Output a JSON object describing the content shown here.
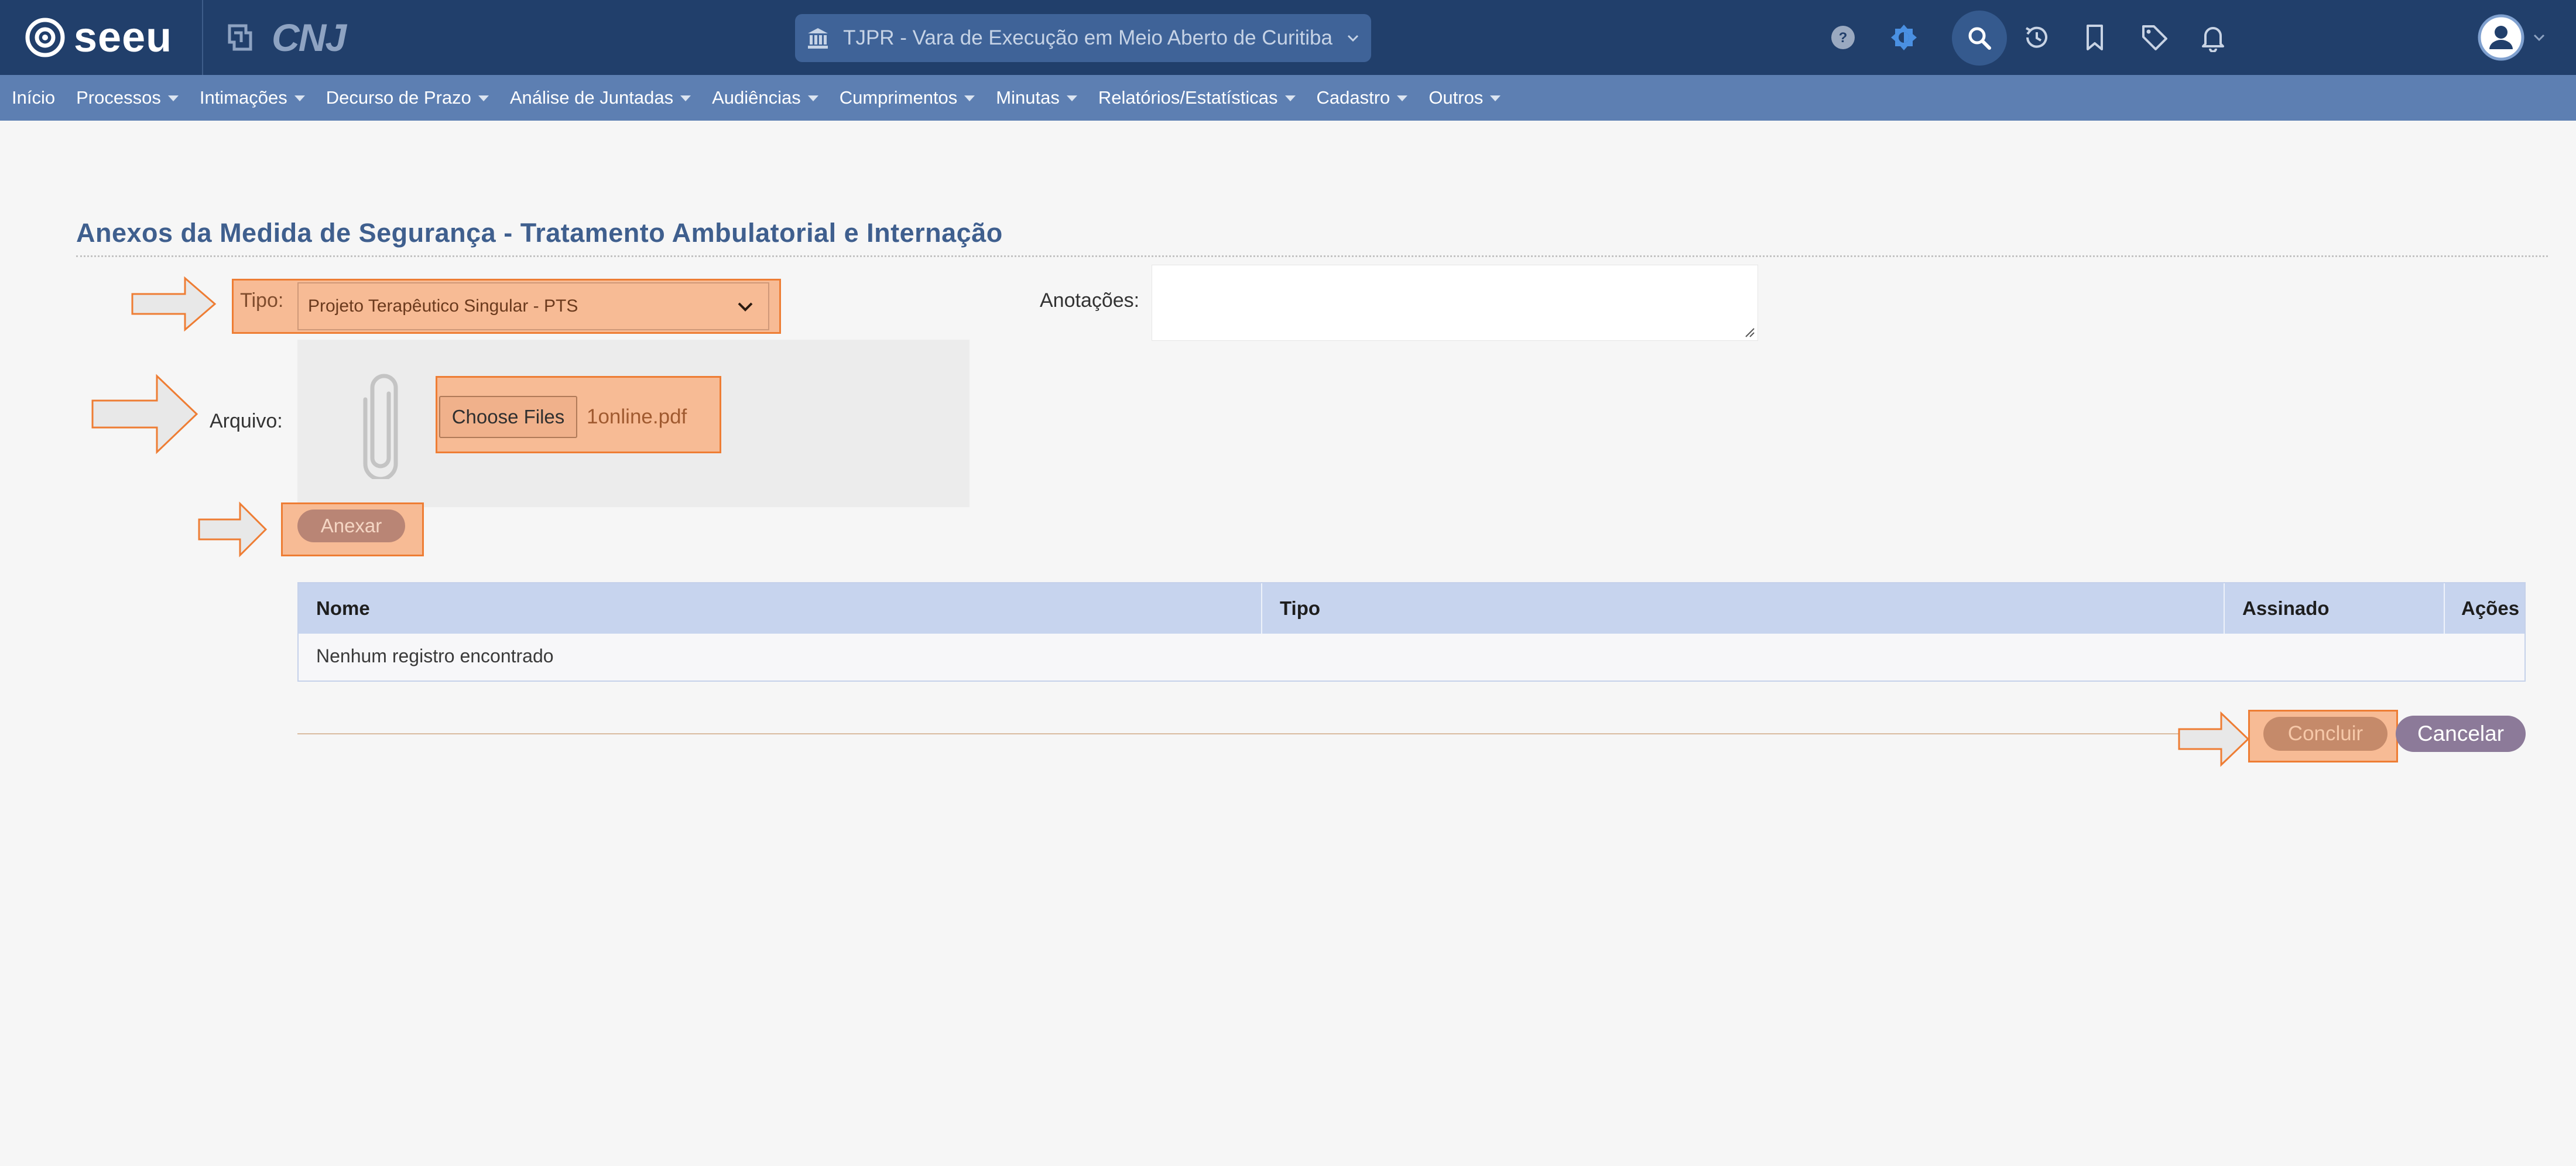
{
  "app": {
    "logo_text": "seeu",
    "partner_logo_text": "CNJ",
    "court_selector": "TJPR - Vara de Execução em Meio Aberto de Curitiba"
  },
  "toolbar_icons": [
    "help-icon",
    "theme-icon",
    "search-icon",
    "history-icon",
    "bookmark-icon",
    "tag-icon",
    "bell-icon",
    "user-avatar-icon"
  ],
  "menu": [
    {
      "label": "Início",
      "dropdown": false
    },
    {
      "label": "Processos",
      "dropdown": true
    },
    {
      "label": "Intimações",
      "dropdown": true
    },
    {
      "label": "Decurso de Prazo",
      "dropdown": true
    },
    {
      "label": "Análise de Juntadas",
      "dropdown": true
    },
    {
      "label": "Audiências",
      "dropdown": true
    },
    {
      "label": "Cumprimentos",
      "dropdown": true
    },
    {
      "label": "Minutas",
      "dropdown": true
    },
    {
      "label": "Relatórios/Estatísticas",
      "dropdown": true
    },
    {
      "label": "Cadastro",
      "dropdown": true
    },
    {
      "label": "Outros",
      "dropdown": true
    }
  ],
  "page": {
    "title": "Anexos da Medida de Segurança - Tratamento Ambulatorial e Internação"
  },
  "form": {
    "tipo_label": "Tipo:",
    "tipo_value": "Projeto Terapêutico Singular - PTS",
    "anotacoes_label": "Anotações:",
    "anotacoes_value": "",
    "arquivo_label": "Arquivo:",
    "choose_files_label": "Choose Files",
    "file_name": "1online.pdf",
    "anexar_label": "Anexar"
  },
  "table": {
    "columns": [
      "Nome",
      "Tipo",
      "Assinado",
      "Ações"
    ],
    "empty_message": "Nenhum registro encontrado"
  },
  "actions": {
    "concluir_label": "Concluir",
    "cancelar_label": "Cancelar"
  },
  "colors": {
    "topbar": "#213f6b",
    "menubar": "#5d7fb2",
    "highlight_fill": "#f7bb95",
    "highlight_border": "#ee7d34",
    "title": "#3f5f8e"
  }
}
